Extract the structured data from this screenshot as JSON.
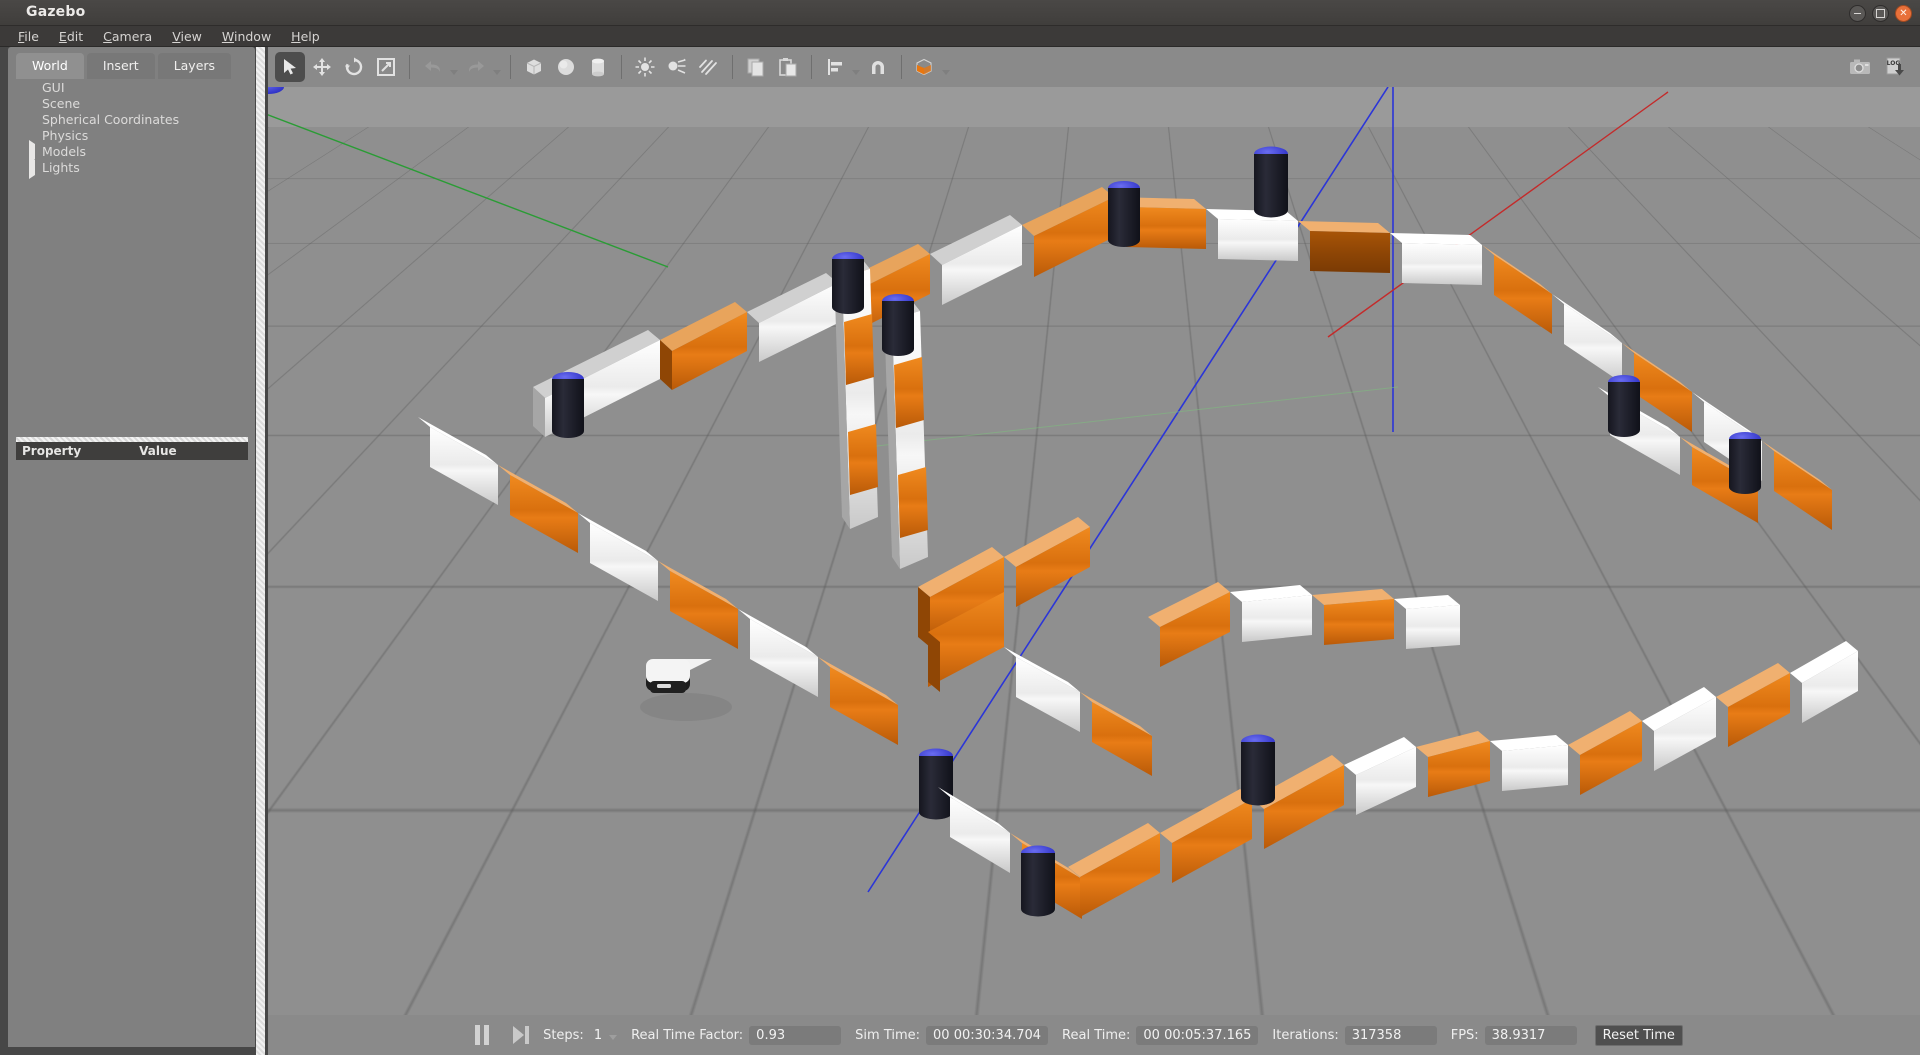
{
  "window": {
    "title": "Gazebo",
    "controls": [
      {
        "name": "minimize",
        "glyph": "–"
      },
      {
        "name": "maximize",
        "glyph": "□"
      },
      {
        "name": "close",
        "glyph": "✕"
      }
    ]
  },
  "menu": [
    {
      "label": "File",
      "mnemonic": "F"
    },
    {
      "label": "Edit",
      "mnemonic": "E"
    },
    {
      "label": "Camera",
      "mnemonic": "C"
    },
    {
      "label": "View",
      "mnemonic": "V"
    },
    {
      "label": "Window",
      "mnemonic": "W"
    },
    {
      "label": "Help",
      "mnemonic": "H"
    }
  ],
  "left_panel": {
    "tabs": [
      {
        "label": "World",
        "active": true
      },
      {
        "label": "Insert",
        "active": false
      },
      {
        "label": "Layers",
        "active": false
      }
    ],
    "tree": [
      {
        "label": "GUI",
        "expandable": false
      },
      {
        "label": "Scene",
        "expandable": false
      },
      {
        "label": "Spherical Coordinates",
        "expandable": false
      },
      {
        "label": "Physics",
        "expandable": false
      },
      {
        "label": "Models",
        "expandable": true
      },
      {
        "label": "Lights",
        "expandable": true
      }
    ],
    "property_table": {
      "col_property": "Property",
      "col_value": "Value",
      "rows": []
    }
  },
  "toolbar": {
    "left_tools": [
      {
        "name": "select-mode",
        "label": "Select",
        "active": true
      },
      {
        "name": "translate-mode",
        "label": "Translate",
        "active": false
      },
      {
        "name": "rotate-mode",
        "label": "Rotate",
        "active": false
      },
      {
        "name": "scale-mode",
        "label": "Scale",
        "active": false
      },
      {
        "name": "undo",
        "label": "Undo",
        "active": false
      },
      {
        "name": "redo",
        "label": "Redo",
        "active": false
      },
      {
        "name": "insert-box",
        "label": "Box",
        "active": false
      },
      {
        "name": "insert-sphere",
        "label": "Sphere",
        "active": false
      },
      {
        "name": "insert-cylinder",
        "label": "Cylinder",
        "active": false
      },
      {
        "name": "point-light",
        "label": "Point Light",
        "active": false
      },
      {
        "name": "spot-light",
        "label": "Spot Light",
        "active": false
      },
      {
        "name": "directional-light",
        "label": "Directional Light",
        "active": false
      },
      {
        "name": "copy",
        "label": "Copy",
        "active": false
      },
      {
        "name": "paste",
        "label": "Paste",
        "active": false
      },
      {
        "name": "align",
        "label": "Align",
        "active": false
      },
      {
        "name": "snap",
        "label": "Snap",
        "active": false
      },
      {
        "name": "view-angle",
        "label": "View Angle",
        "active": false
      }
    ],
    "right_tools": [
      {
        "name": "screenshot",
        "label": "Screenshot"
      },
      {
        "name": "log-record",
        "label": "LOG"
      }
    ],
    "log_icon_text": "LOG"
  },
  "status_bar": {
    "pause_label": "Pause",
    "step_label": "Step",
    "steps_label": "Steps:",
    "steps_value": "1",
    "rtf_label": "Real Time Factor:",
    "rtf_value": "0.93",
    "sim_time_label": "Sim Time:",
    "sim_time_value": "00 00:30:34.704",
    "real_time_label": "Real Time:",
    "real_time_value": "00 00:05:37.165",
    "iterations_label": "Iterations:",
    "iterations_value": "317358",
    "fps_label": "FPS:",
    "fps_value": "38.9317",
    "reset_label": "Reset Time"
  },
  "scene": {
    "description": "Gazebo 3D viewport showing an orange-and-white guardrail barrier race track with dark blue-topped cylinder posts and a small white robot on a grey grid ground plane",
    "sky_color": "#9a9a9a",
    "ground_color": "#8f8f8f",
    "grid_color": "#5a5a5a",
    "barrier_orange": "#e07a13",
    "barrier_white": "#f4f4f4",
    "post_body_color": "#22232e",
    "post_top_color": "#3d3fd6",
    "robot_top_color": "#f2f2f2",
    "robot_body_color": "#1d1d1d",
    "axis_x_color": "#cc2222",
    "axis_y_color": "#22aa33",
    "axis_z_color": "#2b35d8"
  }
}
